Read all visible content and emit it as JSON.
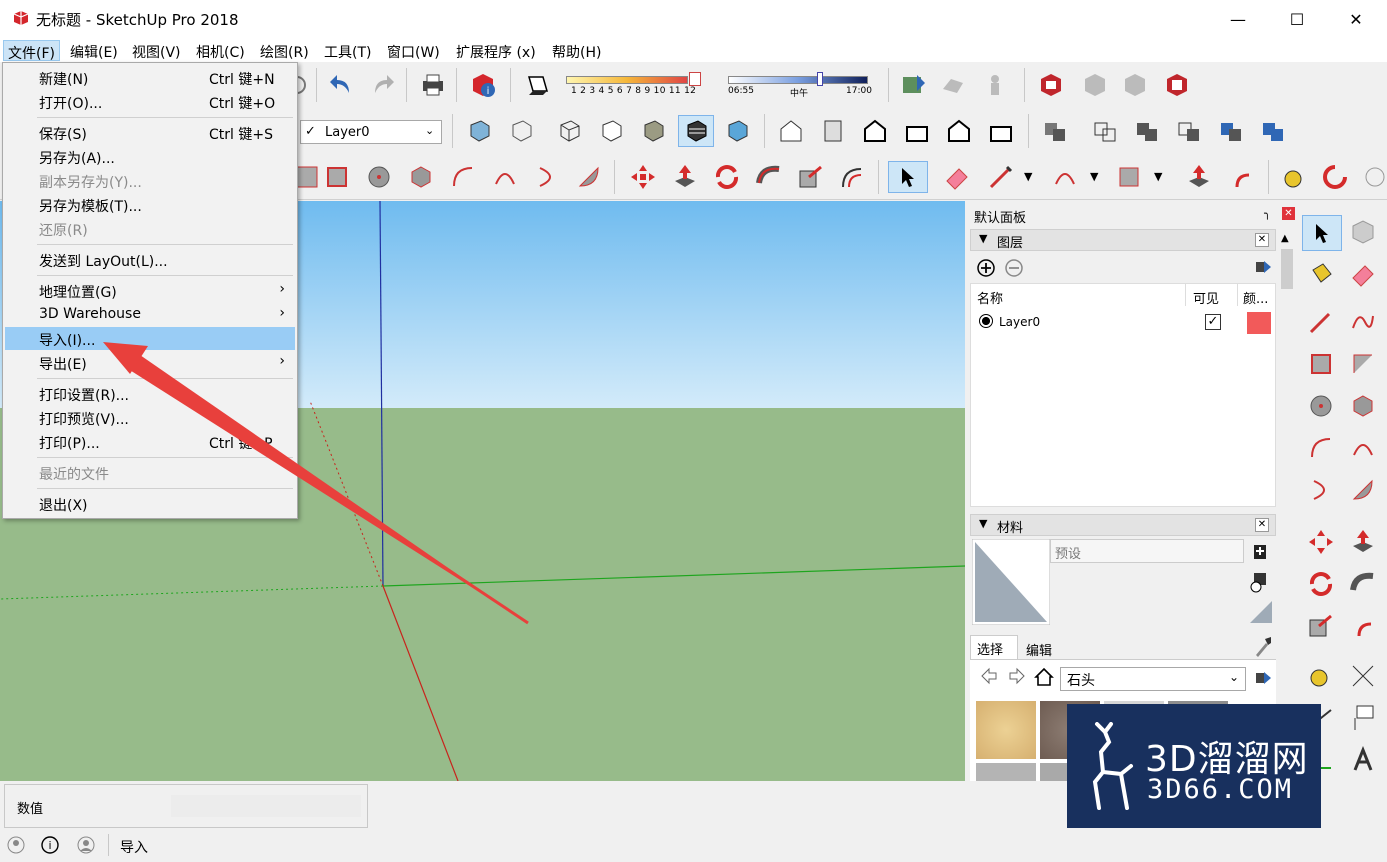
{
  "window": {
    "title": "无标题 - SketchUp Pro 2018",
    "icons": [
      "sketchup-logo-icon",
      "minimize-icon",
      "maximize-icon",
      "close-icon"
    ]
  },
  "menubar": [
    "文件(F)",
    "编辑(E)",
    "视图(V)",
    "相机(C)",
    "绘图(R)",
    "工具(T)",
    "窗口(W)",
    "扩展程序 (x)",
    "帮助(H)"
  ],
  "file_menu": {
    "items": [
      {
        "label": "新建(N)",
        "shortcut": "Ctrl 键+N"
      },
      {
        "label": "打开(O)...",
        "shortcut": "Ctrl 键+O"
      },
      {
        "label": "保存(S)",
        "shortcut": "Ctrl 键+S"
      },
      {
        "label": "另存为(A)..."
      },
      {
        "label": "副本另存为(Y)...",
        "disabled": true
      },
      {
        "label": "另存为模板(T)..."
      },
      {
        "label": "还原(R)",
        "disabled": true
      },
      {
        "label": "发送到 LayOut(L)..."
      },
      {
        "label": "地理位置(G)",
        "submenu": true
      },
      {
        "label": "3D Warehouse",
        "submenu": true
      },
      {
        "label": "导入(I)...",
        "highlighted": true
      },
      {
        "label": "导出(E)",
        "submenu": true
      },
      {
        "label": "打印设置(R)..."
      },
      {
        "label": "打印预览(V)..."
      },
      {
        "label": "打印(P)...",
        "shortcut": "Ctrl 键+P"
      },
      {
        "label": "最近的文件",
        "disabled": true
      },
      {
        "label": "退出(X)"
      }
    ],
    "submenu_arrow": "›"
  },
  "toolbar": {
    "shadow_months": "1 2 3 4 5 6 7 8 9 10 11 12",
    "shadow_time_start": "06:55",
    "shadow_time_mid": "中午",
    "shadow_time_end": "17:00",
    "layer_select": "Layer0"
  },
  "tray": {
    "title": "默认面板",
    "layers": {
      "title": "图层",
      "col_name": "名称",
      "col_visible": "可见",
      "col_color": "颜...",
      "rows": [
        {
          "name": "Layer0",
          "visible": true,
          "color": "#f25a5a"
        }
      ]
    },
    "materials": {
      "title": "材料",
      "name_placeholder": "预设",
      "tab_select": "选择",
      "tab_edit": "编辑",
      "library": "石头"
    }
  },
  "valuebar": {
    "label": "数值"
  },
  "statusbar": {
    "text": "导入"
  },
  "watermark": {
    "title": "3D溜溜网",
    "domain": "3D66.COM"
  },
  "colors": {
    "sky_top": "#6fbbef",
    "ground": "#97bb8a",
    "highlight": "#99ccf5",
    "arrow": "#e8403c",
    "axis_blue": "#1f2fa0",
    "axis_red": "#c8231c",
    "axis_green": "#1ea51e"
  }
}
